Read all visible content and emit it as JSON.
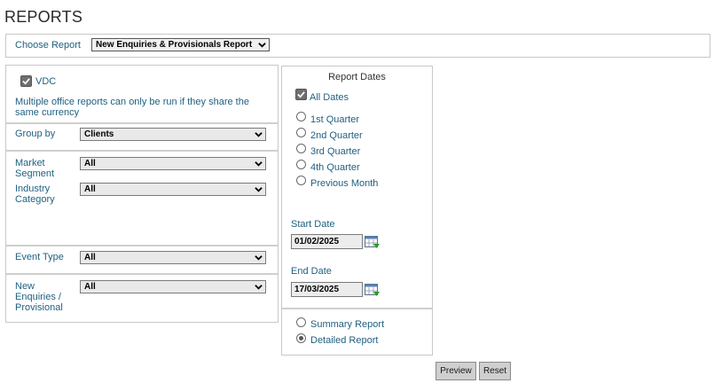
{
  "page": {
    "title": "REPORTS"
  },
  "choose_report": {
    "label": "Choose Report",
    "selected": "New Enquiries & Provisionals Report"
  },
  "left_panel": {
    "vdc": {
      "label": "VDC",
      "checked": true
    },
    "note": "Multiple office reports can only be run if they share the same currency",
    "group_by": {
      "label": "Group by",
      "selected": "Clients"
    },
    "market_segment": {
      "label": "Market Segment",
      "selected": "All"
    },
    "industry_category": {
      "label": "Industry Category",
      "selected": "All"
    },
    "event_type": {
      "label": "Event Type",
      "selected": "All"
    },
    "new_enquiries": {
      "label": "New Enquiries / Provisional",
      "selected": "All"
    }
  },
  "report_dates": {
    "heading": "Report Dates",
    "all_dates": {
      "label": "All Dates",
      "checked": true
    },
    "options": [
      {
        "label": "1st Quarter",
        "selected": false
      },
      {
        "label": "2nd Quarter",
        "selected": false
      },
      {
        "label": "3rd Quarter",
        "selected": false
      },
      {
        "label": "4th Quarter",
        "selected": false
      },
      {
        "label": "Previous Month",
        "selected": false
      }
    ],
    "start_date": {
      "label": "Start Date",
      "value": "01/02/2025"
    },
    "end_date": {
      "label": "End Date",
      "value": "17/03/2025"
    }
  },
  "report_type": {
    "options": [
      {
        "label": "Summary Report",
        "selected": false
      },
      {
        "label": "Detailed Report",
        "selected": true
      }
    ]
  },
  "buttons": {
    "preview": "Preview",
    "reset": "Reset"
  },
  "icons": {
    "checkbox": "checkmark-icon",
    "dropdown": "chevron-down-icon",
    "calendar": "calendar-icon"
  }
}
